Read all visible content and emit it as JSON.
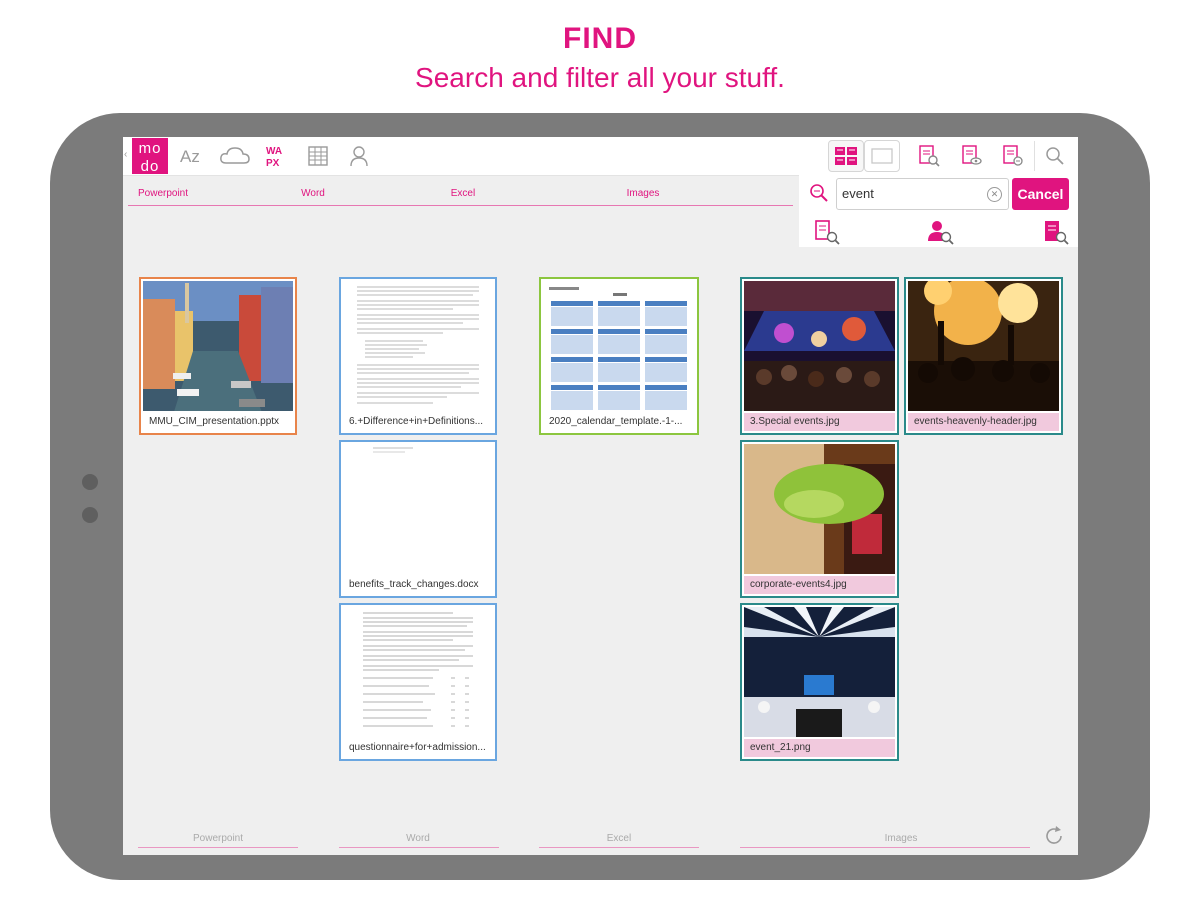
{
  "promo": {
    "title": "FIND",
    "subtitle": "Search and filter all your stuff."
  },
  "app": {
    "logo_top": "mo",
    "logo_bottom": "do",
    "toolbar_icons": [
      "az-sort-icon",
      "cloud-icon",
      "wapx-icon",
      "calendar-grid-icon",
      "person-icon"
    ],
    "toolbar_right_icons": [
      "grid-view-icon",
      "single-view-icon",
      "document-search-icon",
      "document-view-icon",
      "document-filter-icon",
      "search-icon"
    ]
  },
  "tabs": [
    "Powerpoint",
    "Word",
    "Excel",
    "Images"
  ],
  "search": {
    "value": "event",
    "placeholder": "",
    "cancel_label": "Cancel"
  },
  "search_filters": [
    "document-search-icon",
    "user-search-icon",
    "file-search-icon"
  ],
  "files": {
    "powerpoint": [
      {
        "name": "MMU_CIM_presentation.pptx"
      }
    ],
    "word": [
      {
        "name": "6.+Difference+in+Definitions..."
      },
      {
        "name": "benefits_track_changes.docx"
      },
      {
        "name": "questionnaire+for+admission..."
      }
    ],
    "excel": [
      {
        "name": "2020_calendar_template.-1-..."
      }
    ],
    "images": [
      {
        "name": "3.Special events.jpg"
      },
      {
        "name": "events-heavenly-header.jpg"
      },
      {
        "name": "corporate-events4.jpg"
      },
      {
        "name": "event_21.png"
      }
    ]
  },
  "bottom_tabs": [
    "Powerpoint",
    "Word",
    "Excel",
    "Images"
  ],
  "colors": {
    "accent": "#e0147f",
    "powerpoint_border": "#e8844a",
    "word_border": "#6aa6e0",
    "excel_border": "#8cc63f",
    "images_border": "#2a8a8a",
    "image_caption_bg": "#f1c9dd"
  }
}
